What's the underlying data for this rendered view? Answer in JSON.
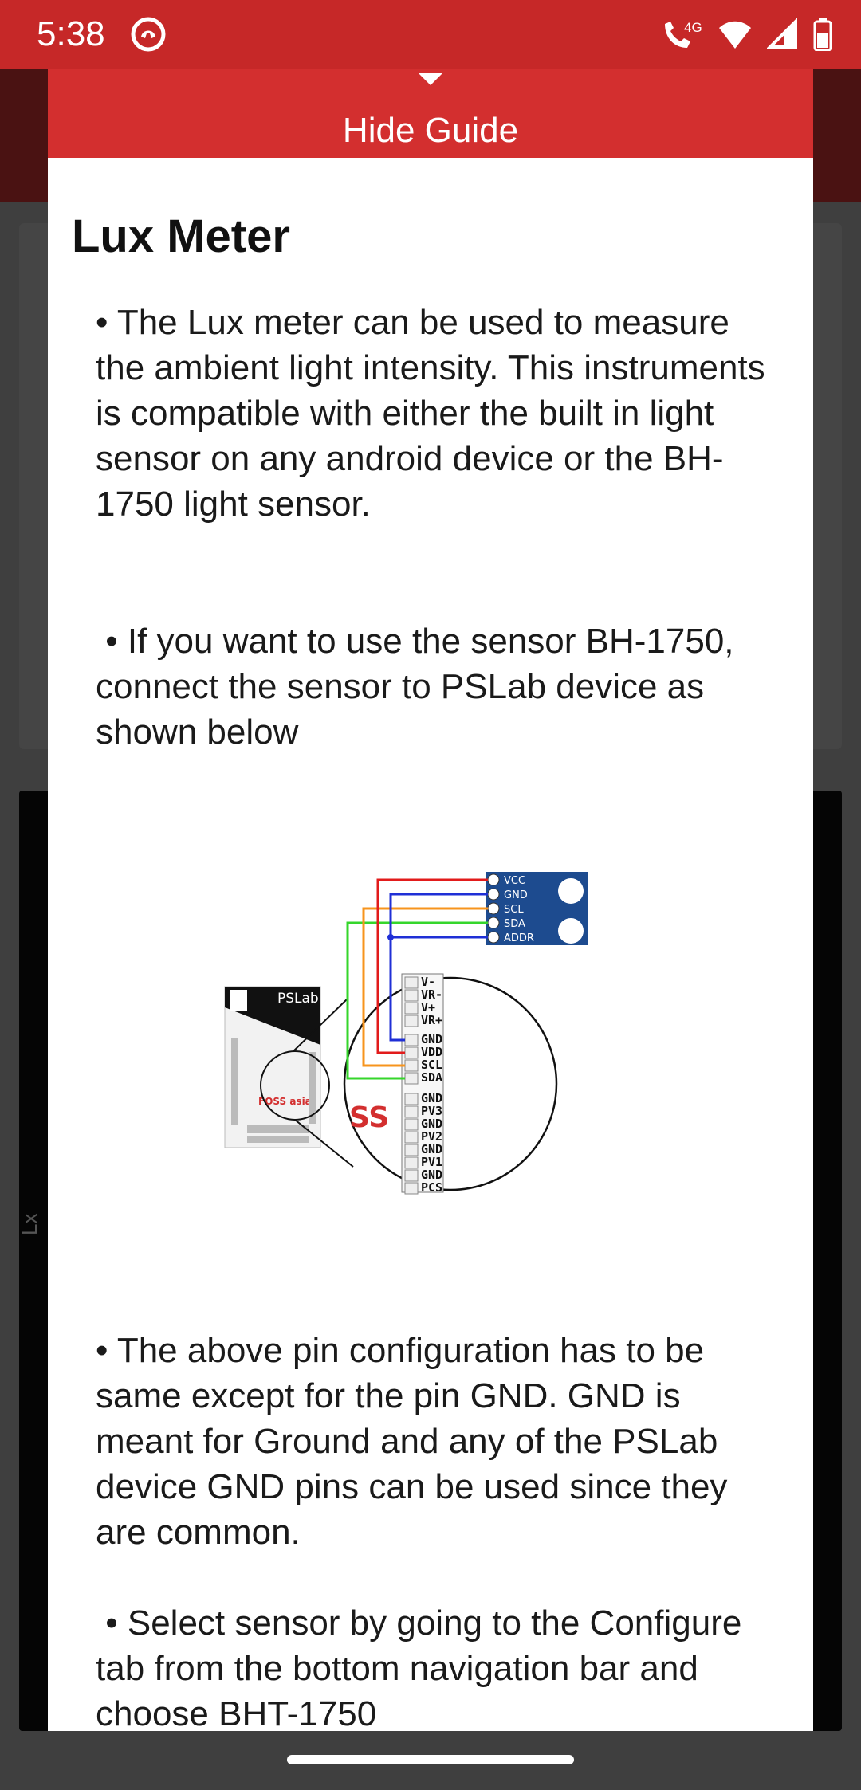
{
  "status": {
    "time": "5:38",
    "network": "4G"
  },
  "background": {
    "axis_label": "Lx"
  },
  "guide": {
    "toggle_label": "Hide Guide",
    "title": "Lux Meter",
    "paragraphs": [
      "• The Lux meter can be used to measure the ambient light intensity. This instruments is compatible with either the built in light sensor on any android device or the BH-1750 light sensor.",
      " • If you want to use the sensor BH-1750, connect the sensor to PSLab device as shown below",
      "• The above pin configuration has to be same except for the pin GND. GND is meant for Ground and any of the PSLab device GND pins can be used since they are common.",
      " • Select sensor by going to the Configure tab from the bottom navigation bar and choose BHT-1750"
    ]
  },
  "diagram": {
    "board_label": "PSLab",
    "logo_text": "FOSS asia",
    "sensor_pins": [
      "VCC",
      "GND",
      "SCL",
      "SDA",
      "ADDR"
    ],
    "connector_pins_top": [
      "V-",
      "VR-",
      "V+",
      "VR+",
      "GND",
      "VDD",
      "SCL",
      "SDA"
    ],
    "connector_pins_bottom": [
      "GND",
      "PV3",
      "GND",
      "PV2",
      "GND",
      "PV1",
      "GND",
      "PCS"
    ],
    "wire_colors": {
      "vcc": "#e21b1b",
      "gnd": "#1f2fd6",
      "scl": "#f7941d",
      "sda": "#35d62b"
    }
  }
}
